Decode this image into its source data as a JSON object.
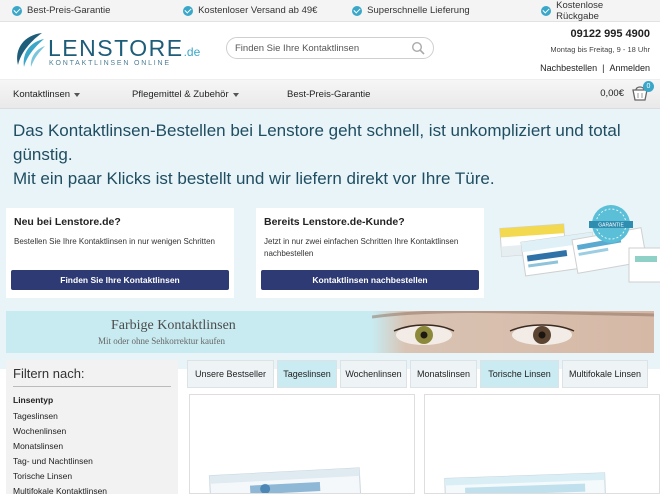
{
  "topbar": {
    "benefits": [
      "Best-Preis-Garantie",
      "Kostenloser Versand ab 49€",
      "Superschnelle Lieferung",
      "Kostenlose Rückgabe"
    ]
  },
  "header": {
    "logo_name": "LENSTORE",
    "logo_tld": ".de",
    "logo_tagline": "KONTAKTLINSEN ONLINE",
    "search_placeholder": "Finden Sie Ihre Kontaktlinsen",
    "phone": "09122 995 4900",
    "hours": "Montag bis Freitag, 9 - 18 Uhr",
    "reorder_link": "Nachbestellen",
    "separator": "|",
    "login_link": "Anmelden"
  },
  "nav": {
    "items": [
      "Kontaktlinsen",
      "Pflegemittel & Zubehör",
      "Best-Preis-Garantie"
    ],
    "cart_total": "0,00€",
    "cart_count": "0"
  },
  "hero": {
    "headline_1": "Das Kontaktlinsen-Bestellen bei Lenstore geht schnell, ist unkompliziert und total günstig.",
    "headline_2": "Mit ein paar Klicks ist bestellt und wir liefern direkt vor Ihre Türe.",
    "new_customer": {
      "title": "Neu bei Lenstore.de?",
      "text": "Bestellen Sie Ihre Kontaktlinsen in nur wenigen Schritten",
      "button": "Finden Sie Ihre Kontaktlinsen"
    },
    "existing_customer": {
      "title": "Bereits Lenstore.de-Kunde?",
      "text": "Jetzt in nur zwei einfachen Schritten Ihre Kontaktlinsen nachbestellen",
      "button": "Kontaktlinsen nachbestellen"
    },
    "products_badge": "GARANTIE"
  },
  "banner": {
    "title": "Farbige Kontaktlinsen",
    "subtitle": "Mit oder ohne Sehkorrektur kaufen"
  },
  "filter": {
    "title": "Filtern nach:",
    "heading": "Linsentyp",
    "options": [
      "Tageslinsen",
      "Wochenlinsen",
      "Monatslinsen",
      "Tag- und Nachtlinsen",
      "Torische Linsen",
      "Multifokale Kontaktlinsen"
    ]
  },
  "tabs": [
    "Unsere Bestseller",
    "Tageslinsen",
    "Wochenlinsen",
    "Monatslinsen",
    "Torische Linsen",
    "Multifokale Linsen"
  ],
  "colors": {
    "brand_navy": "#2d3a73",
    "accent": "#3aa7c9",
    "hero_bg": "#e8f4f8",
    "banner_bg": "#c8ebf1"
  }
}
